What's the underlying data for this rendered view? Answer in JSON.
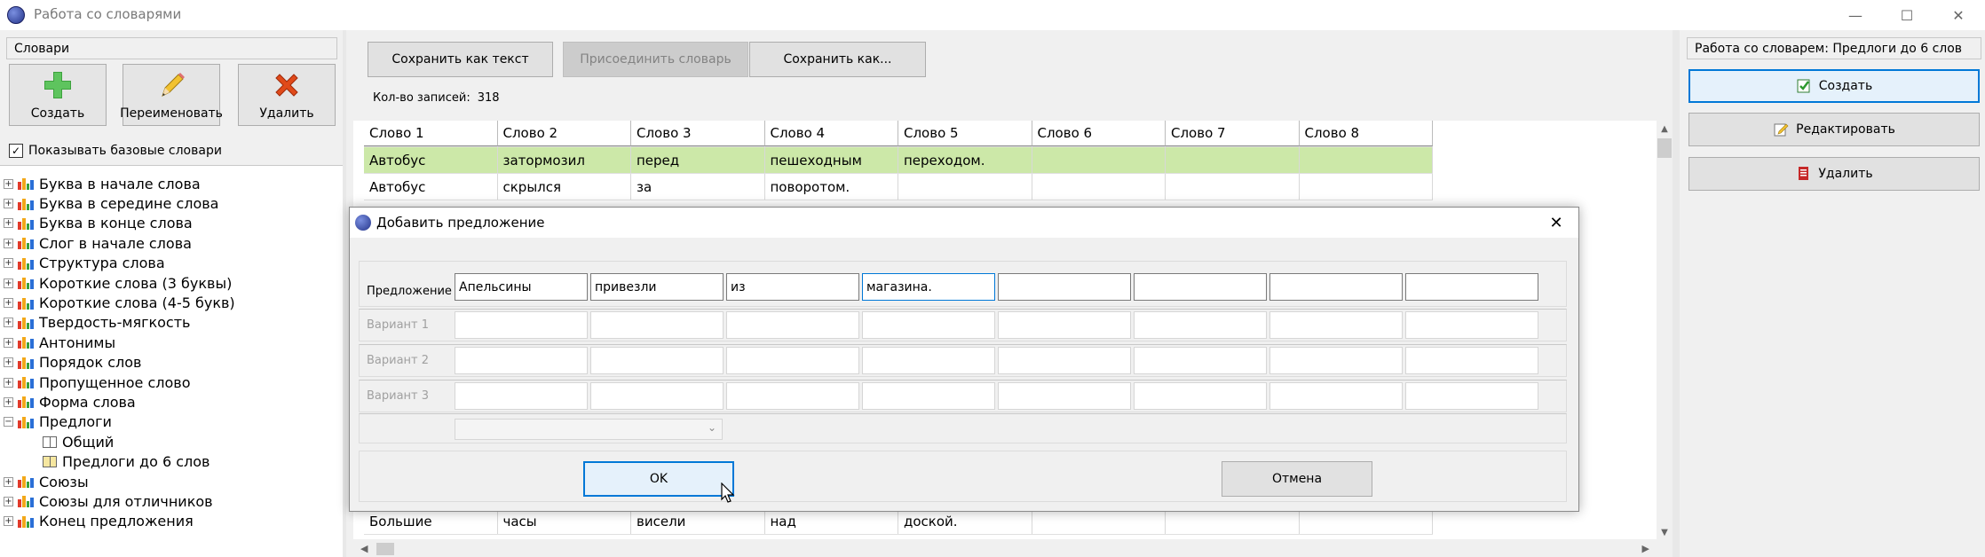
{
  "window": {
    "title": "Работа со словарями",
    "minimize_glyph": "—",
    "maximize_glyph": "☐",
    "close_glyph": "✕"
  },
  "left": {
    "panel_label": "Словари",
    "create_label": "Создать",
    "rename_label": "Переименовать",
    "delete_label": "Удалить",
    "show_base_label": "Показывать базовые словари",
    "show_base_checked": true,
    "tree": [
      {
        "label": "Буква в начале слова",
        "expanded": false
      },
      {
        "label": "Буква в середине слова",
        "expanded": false
      },
      {
        "label": "Буква в конце слова",
        "expanded": false
      },
      {
        "label": "Слог в начале слова",
        "expanded": false
      },
      {
        "label": "Структура слова",
        "expanded": false
      },
      {
        "label": "Короткие слова (3 буквы)",
        "expanded": false
      },
      {
        "label": "Короткие слова (4-5 букв)",
        "expanded": false
      },
      {
        "label": "Твердость-мягкость",
        "expanded": false
      },
      {
        "label": "Антонимы",
        "expanded": false
      },
      {
        "label": "Порядок слов",
        "expanded": false
      },
      {
        "label": "Пропущенное слово",
        "expanded": false
      },
      {
        "label": "Форма слова",
        "expanded": false
      },
      {
        "label": "Предлоги",
        "expanded": true,
        "children": [
          "Общий",
          "Предлоги до 6 слов"
        ]
      },
      {
        "label": "Союзы",
        "expanded": false
      },
      {
        "label": "Союзы для отличников",
        "expanded": false
      },
      {
        "label": "Конец предложения",
        "expanded": false
      }
    ]
  },
  "middle": {
    "save_text_label": "Сохранить как текст",
    "attach_label": "Присоединить словарь",
    "save_as_label": "Сохранить как...",
    "record_count_label": "Кол-во записей:",
    "record_count": "318",
    "columns": [
      "Слово 1",
      "Слово 2",
      "Слово 3",
      "Слово 4",
      "Слово 5",
      "Слово 6",
      "Слово 7",
      "Слово 8"
    ],
    "rows": [
      [
        "Автобус",
        "затормозил",
        "перед",
        "пешеходным",
        "переходом.",
        "",
        "",
        ""
      ],
      [
        "Автобус",
        "скрылся",
        "за",
        "поворотом.",
        "",
        "",
        "",
        ""
      ]
    ],
    "bottom_row": [
      "Большие",
      "часы",
      "висели",
      "над",
      "доской.",
      "",
      "",
      ""
    ],
    "selected_row_color": "#cce8a8"
  },
  "right": {
    "panel_label": "Работа со словарем: Предлоги до 6 слов",
    "create_label": "Создать",
    "edit_label": "Редактировать",
    "delete_label": "Удалить"
  },
  "dialog": {
    "title": "Добавить предложение",
    "sentence_label": "Предложение",
    "sentence_words": [
      "Апельсины",
      "привезли",
      "из",
      "магазина.",
      "",
      "",
      "",
      ""
    ],
    "variant_labels": [
      "Вариант 1",
      "Вариант 2",
      "Вариант 3"
    ],
    "ok_label": "OK",
    "cancel_label": "Отмена"
  }
}
